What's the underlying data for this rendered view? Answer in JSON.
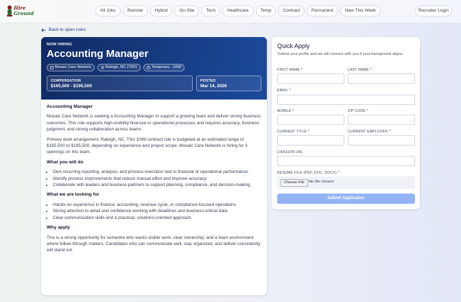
{
  "brand": {
    "line1": "Hire",
    "line2": "Ground"
  },
  "nav": {
    "items": [
      "All Jobs",
      "Remote",
      "Hybrid",
      "On-Site",
      "Tech",
      "Healthcare",
      "Temp",
      "Contract",
      "Permanent",
      "New This Week"
    ],
    "recruiter_login": "Recruiter Login"
  },
  "back_link": "Back to open roles",
  "job": {
    "eyebrow": "NOW HIRING",
    "title": "Accounting Manager",
    "company": "Mosaic Care Network",
    "location": "Raleigh, NC 27601",
    "employment_type": "Temporary - 1099",
    "compensation_label": "COMPENSATION",
    "compensation_value": "$165,500 - $195,500",
    "posted_label": "POSTED",
    "posted_value": "Mar 14, 2026",
    "section_title": "Accounting Manager",
    "intro": "Mosaic Care Network is seeking a Accounting Manager to support a growing team and deliver strong business outcomes. This role supports high-visibility financial or operational processes and requires accuracy, business judgment, and strong collaboration across teams.",
    "arrangement": "Primary work arrangement: Raleigh, NC. This 1099 contract role is budgeted at an estimated range of $165,500 to $195,500, depending on experience and project scope. Mosaic Care Network is hiring for 3 openings on this team.",
    "what_you_do_title": "What you will do",
    "what_you_do": [
      "Own recurring reporting, analysis, and process execution tied to financial or operational performance.",
      "Identify process improvements that reduce manual effort and improve accuracy.",
      "Collaborate with leaders and business partners to support planning, compliance, and decision-making."
    ],
    "looking_for_title": "What we are looking for",
    "looking_for": [
      "Hands-on experience in finance, accounting, revenue cycle, or compliance-focused operations.",
      "Strong attention to detail and confidence working with deadlines and business-critical data.",
      "Clear communication skills and a practical, solutions-oriented approach."
    ],
    "why_apply_title": "Why apply",
    "why_apply": "This is a strong opportunity for someone who wants visible work, clear ownership, and a team environment where follow-through matters. Candidates who can communicate well, stay organized, and deliver consistently will stand out."
  },
  "apply": {
    "title": "Quick Apply",
    "subtitle": "Submit your profile and we will connect with you if your background aligns.",
    "first_name": "FIRST NAME *",
    "last_name": "LAST NAME *",
    "email": "EMAIL *",
    "mobile": "MOBILE *",
    "zip": "ZIP CODE *",
    "current_title": "CURRENT TITLE *",
    "current_employer": "CURRENT EMPLOYER *",
    "linkedin": "LINKEDIN URL",
    "resume": "RESUME FILE (PDF, DOC, DOCX) *",
    "choose_file": "Choose File",
    "no_file": "No file chosen",
    "submit": "Submit Application"
  },
  "colors": {
    "hero": "#1c4a9c",
    "submit": "#93b4f4",
    "link": "#1e3a8a"
  }
}
